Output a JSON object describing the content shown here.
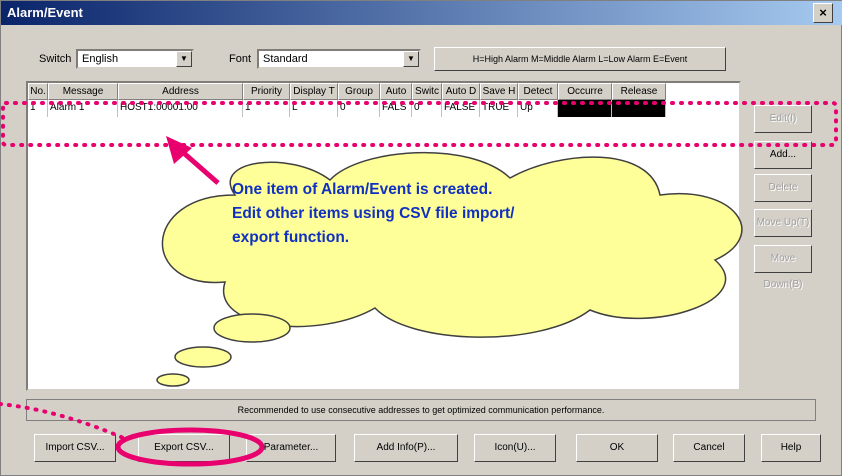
{
  "window": {
    "title": "Alarm/Event",
    "close_symbol": "×"
  },
  "controls": {
    "switch_label": "Switch",
    "switch_value": "English",
    "font_label": "Font",
    "font_value": "Standard",
    "legend_text": "H=High Alarm M=Middle Alarm L=Low Alarm E=Event"
  },
  "table": {
    "columns": [
      "No.",
      "Message",
      "Address",
      "Priority",
      "Display T",
      "Group",
      "Auto",
      "Switc",
      "Auto D",
      "Save H",
      "Detect",
      "Occurre",
      "Release"
    ],
    "rows": [
      [
        "1",
        "Alarm 1",
        "HOST1:00001.00",
        "1",
        "L",
        "0",
        "FALS",
        "0",
        "FALSE",
        "TRUE",
        "Up",
        "",
        ""
      ]
    ]
  },
  "side_buttons": {
    "edit": "Edit(I)",
    "add": "Add...",
    "delete": "Delete",
    "move_up": "Move Up(T)",
    "move_down": "Move Down(B)"
  },
  "status_text": "Recommended to use consecutive addresses to get optimized communication performance.",
  "bottom_buttons": {
    "import_csv": "Import CSV...",
    "export_csv": "Export CSV...",
    "parameter": "Parameter...",
    "add_info": "Add Info(P)...",
    "icon": "Icon(U)...",
    "ok": "OK",
    "cancel": "Cancel",
    "help": "Help"
  },
  "callout": {
    "lines": [
      "One item of Alarm/Event is created.",
      "Edit other items using CSV file import/",
      "export function."
    ]
  },
  "colors": {
    "annotation_pink": "#e8006e",
    "cloud_fill": "#ffff99",
    "callout_text": "#1030c0",
    "title_bar": "#0a246a"
  }
}
